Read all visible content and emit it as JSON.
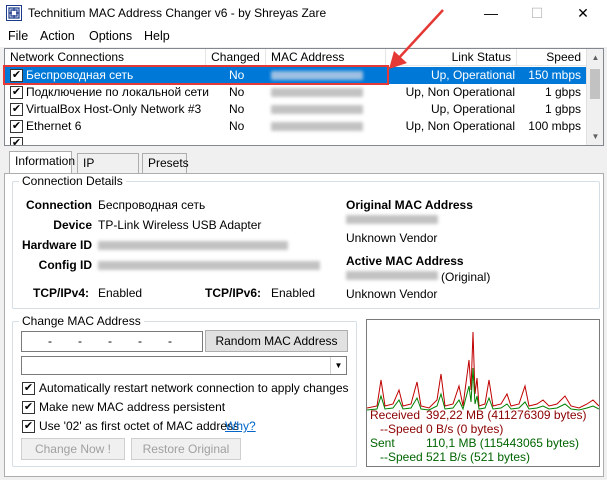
{
  "window": {
    "title": "Technitium MAC Address Changer v6 - by Shreyas Zare",
    "minimize_glyph": "—",
    "maximize_glyph": "☐",
    "close_glyph": "✕"
  },
  "menu": [
    "File",
    "Action",
    "Options",
    "Help"
  ],
  "network_list": {
    "columns": [
      "Network Connections",
      "Changed",
      "MAC Address",
      "Link Status",
      "Speed"
    ],
    "rows": [
      {
        "checked": true,
        "name": "Беспроводная сеть",
        "changed": "No",
        "mac": "50-0E-AA-05-77-28",
        "status": "Up, Operational",
        "speed": "150 mbps",
        "selected": true
      },
      {
        "checked": true,
        "name": "Подключение по локальной сети",
        "changed": "No",
        "mac": "00-FF-32-B0-64-06",
        "status": "Up, Non Operational",
        "speed": "1 gbps",
        "selected": false
      },
      {
        "checked": true,
        "name": "VirtualBox Host-Only Network #3",
        "changed": "No",
        "mac": "0A-00-27-00-00-06",
        "status": "Up, Operational",
        "speed": "1 gbps",
        "selected": false
      },
      {
        "checked": true,
        "name": "Ethernet 6",
        "changed": "No",
        "mac": "00-FF-59-67-83-3D",
        "status": "Up, Non Operational",
        "speed": "100 mbps",
        "selected": false
      }
    ]
  },
  "tabs": [
    "Information",
    "IP Address",
    "Presets"
  ],
  "connection_details": {
    "group_title": "Connection Details",
    "connection_label": "Connection",
    "connection_value": "Беспроводная сеть",
    "device_label": "Device",
    "device_value": "TP-Link Wireless USB Adapter",
    "hardware_id_label": "Hardware ID",
    "config_id_label": "Config ID",
    "tcpipv4_label": "TCP/IPv4:",
    "tcpipv4_value": "Enabled",
    "tcpipv6_label": "TCP/IPv6:",
    "tcpipv6_value": "Enabled",
    "original_mac_label": "Original MAC Address",
    "original_vendor": "Unknown Vendor",
    "active_mac_label": "Active MAC Address",
    "active_mac_suffix": "(Original)",
    "active_vendor": "Unknown Vendor"
  },
  "change_mac": {
    "group_title": "Change MAC Address",
    "mac_segments": [
      "-",
      "-",
      "-",
      "-",
      "-"
    ],
    "random_button": "Random MAC Address",
    "options": [
      {
        "checked": true,
        "label": "Automatically restart network connection to apply changes"
      },
      {
        "checked": true,
        "label": "Make new MAC address persistent"
      },
      {
        "checked": true,
        "label": "Use '02' as first octet of MAC address"
      }
    ],
    "why_link": "Why?",
    "change_now_button": "Change Now !",
    "restore_button": "Restore Original"
  },
  "traffic": {
    "received_label": "Received",
    "received_value": "392,22 MB (411276309 bytes)",
    "received_speed_label": "--Speed",
    "received_speed_value": "0 B/s (0 bytes)",
    "sent_label": "Sent",
    "sent_value": "110,1 MB (115443065 bytes)",
    "sent_speed_label": "--Speed",
    "sent_speed_value": "521 B/s (521 bytes)"
  },
  "colors": {
    "selection": "#0078d7",
    "annotation": "#e53935",
    "received": "#8b0000",
    "sent": "#006400"
  }
}
